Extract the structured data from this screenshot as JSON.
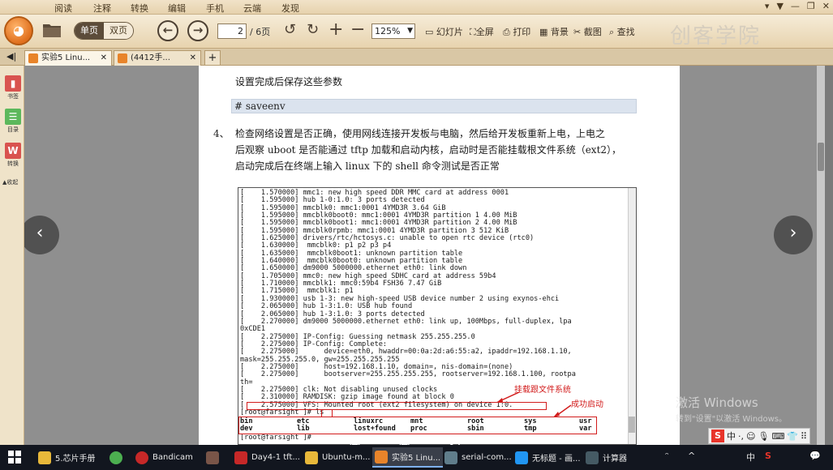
{
  "menu": {
    "items": [
      "阅读",
      "注释",
      "转换",
      "编辑",
      "手机",
      "云端",
      "发现"
    ],
    "window_controls": [
      "▾",
      "▼",
      "—",
      "❐",
      "✕"
    ]
  },
  "toolbar": {
    "single_page": "单页",
    "double_page": "双页",
    "page_current": "2",
    "page_total": "/ 6页",
    "zoom": "125%",
    "slideshow": "幻灯片",
    "fullscreen": "全屏",
    "print": "打印",
    "background": "背景",
    "screenshot": "截图",
    "find": "查找",
    "brand": "创客学院"
  },
  "tabs": [
    {
      "label": "实验5 Linu..."
    },
    {
      "label": "(4412手..."
    }
  ],
  "sidebar": {
    "items": [
      {
        "label": "书签",
        "color": "#d9534f"
      },
      {
        "label": "目录",
        "color": "#5cb85c"
      },
      {
        "label": "转换",
        "color": "#d9534f"
      }
    ],
    "collapse": "▲收起"
  },
  "document": {
    "line_save": "设置完成后保存这些参数",
    "cmd_saveenv": "# saveenv",
    "step_num": "4、",
    "step4_lines": [
      "检查网络设置是否正确，使用网线连接开发板与电脑，然后给开发板重新上电，上电之",
      "后观察 uboot 是否能通过 tftp 加载和启动内核，启动时是否能挂载根文件系统（ext2），",
      "启动完成后在终端上输入 linux 下的 shell 命令测试是否正常"
    ],
    "terminal_log": "[    1.570000] mmc1: new high speed DDR MMC card at address 0001\n[    1.595000] hub 1-0:1.0: 3 ports detected\n[    1.595000] mmcblk0: mmc1:0001 4YMD3R 3.64 GiB\n[    1.595000] mmcblk0boot0: mmc1:0001 4YMD3R partition 1 4.00 MiB\n[    1.595000] mmcblk0boot1: mmc1:0001 4YMD3R partition 2 4.00 MiB\n[    1.595000] mmcblk0rpmb: mmc1:0001 4YMD3R partition 3 512 KiB\n[    1.625000] drivers/rtc/hctosys.c: unable to open rtc device (rtc0)\n[    1.630000]  mmcblk0: p1 p2 p3 p4\n[    1.635000]  mmcblk0boot1: unknown partition table\n[    1.640000]  mmcblk0boot0: unknown partition table\n[    1.650000] dm9000 5000000.ethernet eth0: link down\n[    1.705000] mmc0: new high speed SDHC card at address 59b4\n[    1.710000] mmcblk1: mmc0:59b4 FSH36 7.47 GiB\n[    1.715000]  mmcblk1: p1\n[    1.930000] usb 1-3: new high-speed USB device number 2 using exynos-ehci\n[    2.065000] hub 1-3:1.0: USB hub found\n[    2.065000] hub 1-3:1.0: 3 ports detected\n[    2.270000] dm9000 5000000.ethernet eth0: link up, 100Mbps, full-duplex, lpa\n0xCDE1\n[    2.275000] IP-Config: Guessing netmask 255.255.255.0\n[    2.275000] IP-Config: Complete:\n[    2.275000]      device=eth0, hwaddr=00:0a:2d:a6:55:a2, ipaddr=192.168.1.10,\nmask=255.255.255.0, gw=255.255.255.255\n[    2.275000]      host=192.168.1.10, domain=, nis-domain=(none)\n[    2.275000]      bootserver=255.255.255.255, rootserver=192.168.1.100, rootpa\nth=\n[    2.275000] clk: Not disabling unused clocks\n[    2.310000] RAMDISK: gzip image found at block 0\n[    2.575000] VFS: Mounted root (ext2 filesystem) on device 1:0.\n[root@farsight ]# ls",
    "ls_output": [
      [
        "bin",
        "etc",
        "linuxrc",
        "mnt",
        "root",
        "sys",
        "usr"
      ],
      [
        "dev",
        "lib",
        "lost+found",
        "proc",
        "sbin",
        "tmp",
        "var"
      ]
    ],
    "terminal_prompt": "[root@farsight ]#",
    "annotation_mount": "挂载跟文件系统",
    "annotation_boot": "成功启动",
    "accent_red": "#d21c1c"
  },
  "watermark": {
    "line1": "激活 Windows",
    "line2": "转到\"设置\"以激活 Windows。"
  },
  "ime": {
    "logo": "S",
    "items": [
      "中",
      "·,",
      "☺",
      "🎙",
      "⌨",
      "👕",
      "⠿"
    ]
  },
  "taskbar": {
    "items": [
      {
        "label": "5.芯片手册",
        "color": "#e8b83a"
      },
      {
        "label": "",
        "color": "#4caf50"
      },
      {
        "label": "Bandicam",
        "color": "#c62828"
      },
      {
        "label": "",
        "color": "#795548"
      },
      {
        "label": "Day4-1 tft...",
        "color": "#c62828"
      },
      {
        "label": "Ubuntu-m...",
        "color": "#e8b83a"
      },
      {
        "label": "实验5 Linu...",
        "color": "#e8842a"
      },
      {
        "label": "serial-com...",
        "color": "#607d8b"
      },
      {
        "label": "无标题 - 画...",
        "color": "#2196f3"
      },
      {
        "label": "计算器",
        "color": "#455a64"
      }
    ],
    "tray": [
      "ᵔ",
      "^",
      "中",
      "S",
      "💬"
    ]
  }
}
